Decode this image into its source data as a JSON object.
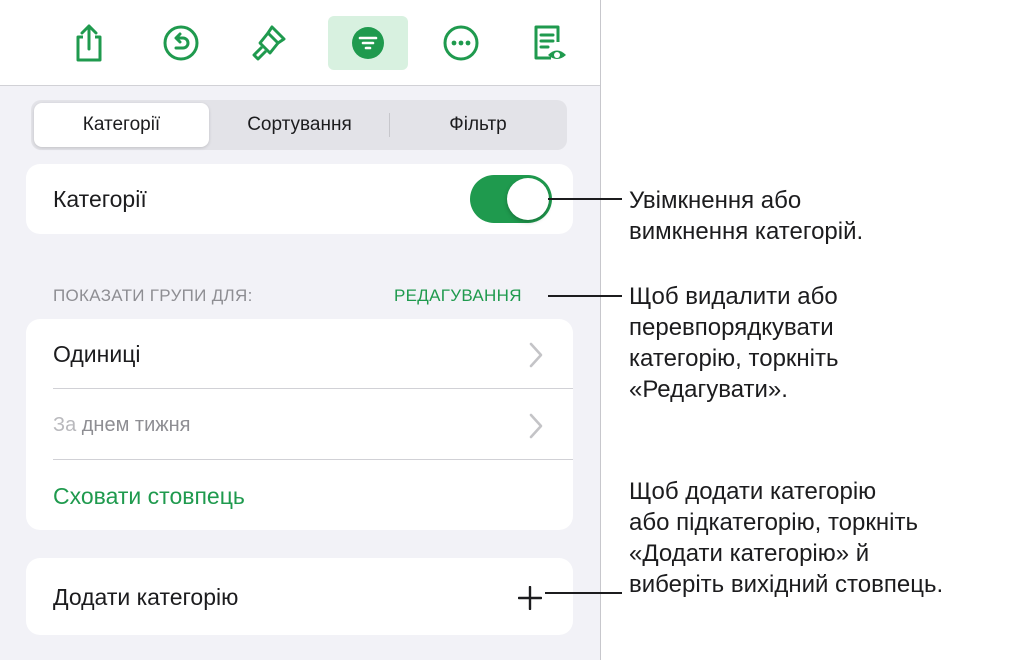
{
  "toolbar": {
    "items": [
      {
        "icon": "share-icon"
      },
      {
        "icon": "undo-icon"
      },
      {
        "icon": "paintbrush-icon"
      },
      {
        "icon": "organize-icon",
        "active": true
      },
      {
        "icon": "more-icon"
      },
      {
        "icon": "reading-view-icon"
      }
    ]
  },
  "tabs": {
    "categories": "Категорії",
    "sort": "Сортування",
    "filter": "Фільтр",
    "selected": "categories"
  },
  "categories_toggle": {
    "label": "Категорії",
    "on": true
  },
  "groups": {
    "header": "ПОКАЗАТИ ГРУПИ ДЛЯ:",
    "edit": "РЕДАГУВАННЯ",
    "rows": [
      {
        "label": "Одиниці"
      },
      {
        "label_prefix": "За",
        "label": "днем тижня"
      }
    ],
    "hide_column": "Сховати стовпець"
  },
  "add_category": {
    "label": "Додати категорію"
  },
  "callouts": {
    "toggle": "Увімкнення або\nвимкнення категорій.",
    "edit": "Щоб видалити або\nперевпорядкувати\nкатегорію, торкніть\n«Редагувати».",
    "add": "Щоб додати категорію\nабо підкатегорію, торкніть\n«Додати категорію» й\nвиберіть вихідний стовпець."
  },
  "colors": {
    "accent": "#1f9a4e",
    "accent_tint": "#d8f1e0",
    "background": "#f2f2f7"
  }
}
